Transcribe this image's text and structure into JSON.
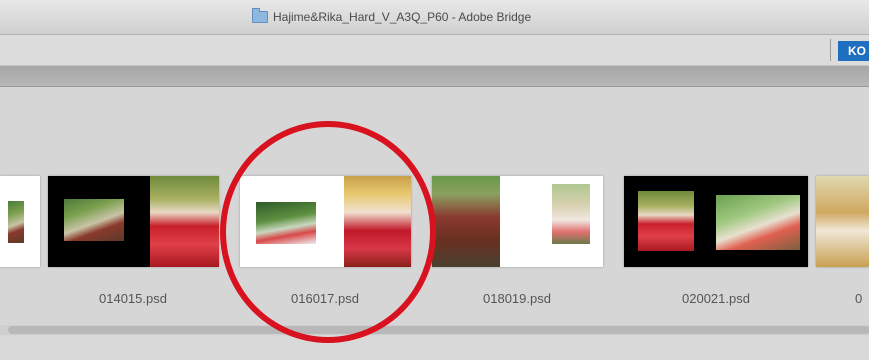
{
  "window": {
    "title": "Hajime&Rika_Hard_V_A3Q_P60 - Adobe Bridge"
  },
  "toolbar": {
    "badge_text": "KO"
  },
  "thumbnails": [
    {
      "filename": "014015.psd"
    },
    {
      "filename": "016017.psd"
    },
    {
      "filename": "018019.psd"
    },
    {
      "filename": "020021.psd"
    },
    {
      "filename": "0"
    }
  ],
  "colors": {
    "highlight_circle": "#d8121f",
    "selected_badge": "#1e6fc0"
  }
}
